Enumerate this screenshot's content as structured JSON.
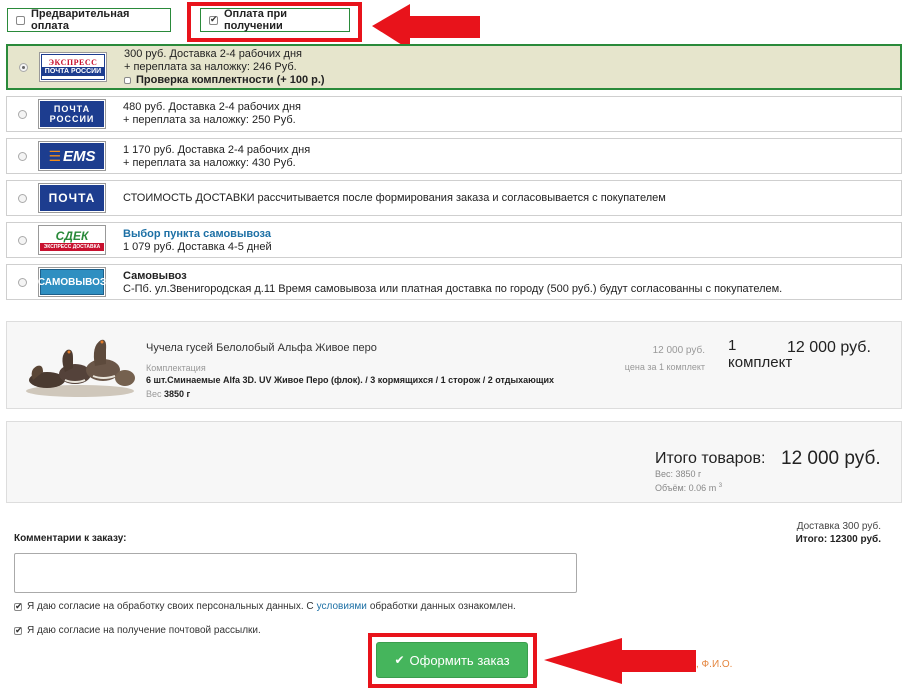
{
  "payment": {
    "prepay_label": "Предварительная оплата",
    "cod_label": "Оплата при получении"
  },
  "delivery_options": [
    {
      "logo_lines": [
        "ЭКСПРЕСС",
        "ПОЧТА РОССИИ"
      ],
      "line1": "300 руб. Доставка 2-4 рабочих дня",
      "line2": "+ переплата за наложку: 246 Руб.",
      "extra_check": "Проверка комплектности (+ 100 р.)"
    },
    {
      "logo_lines": [
        "ПОЧТА",
        "РОССИИ"
      ],
      "line1": "480 руб. Доставка 2-4 рабочих дня",
      "line2": "+ переплата за наложку: 250 Руб."
    },
    {
      "logo_lines": [
        "EMS"
      ],
      "line1": "1 170 руб. Доставка 2-4 рабочих дня",
      "line2": "+ переплата за наложку: 430 Руб."
    },
    {
      "logo_lines": [
        "ПОЧТА"
      ],
      "line1": "СТОИМОСТЬ ДОСТАВКИ рассчитывается после формирования заказа и согласовывается с покупателем"
    },
    {
      "logo_lines": [
        "СДЕК",
        "ЭКСПРЕСС ДОСТАВКА"
      ],
      "line1": "Выбор пункта самовывоза",
      "line2": "1 079 руб. Доставка 4-5 дней"
    },
    {
      "logo_lines": [
        "САМОВЫВОЗ"
      ],
      "line1": "Самовывоз",
      "line2": "С-Пб. ул.Звенигородская д.11 Время самовывоза или платная доставка по городу (500 руб.) будут согласованны с покупателем."
    }
  ],
  "product": {
    "name": "Чучела гусей Белолобый Альфа Живое перо",
    "spec_label": "Комплектация",
    "spec_value": "6 шт.Сминаемые Alfa 3D. UV Живое Перо (флок). / 3 кормящихся / 1 сторож / 2 отдыхающих",
    "weight_label": "Вес",
    "weight_value": "3850 г",
    "unit_price": "12 000 руб.",
    "unit_price_note": "цена за 1 комплект",
    "qty_number": "1",
    "qty_unit": "комплект",
    "total": "12 000 руб."
  },
  "summary": {
    "label": "Итого товаров:",
    "value": "12 000 руб.",
    "weight": "Вес: 3850 г",
    "volume": "Объём: 0.06 m",
    "volume_sup": "3"
  },
  "totals": {
    "delivery": "Доставка 300 руб.",
    "total": "Итого: 12300 руб."
  },
  "comment": {
    "label": "Комментарии к заказу:",
    "value": ""
  },
  "consent1": {
    "before": "Я даю согласие на обработку своих персональных данных. С",
    "link": "условиями",
    "after": "обработки данных ознакомлен."
  },
  "consent2": "Я даю согласие на получение почтовой рассылки.",
  "submit_label": "Оформить заказ",
  "partial_text": ", Ф.И.О.",
  "colors": {
    "accent_green": "#45b55c",
    "highlight_red": "#e8131b",
    "selected_bg": "#e6e5cc",
    "link_blue": "#1d70a5"
  }
}
